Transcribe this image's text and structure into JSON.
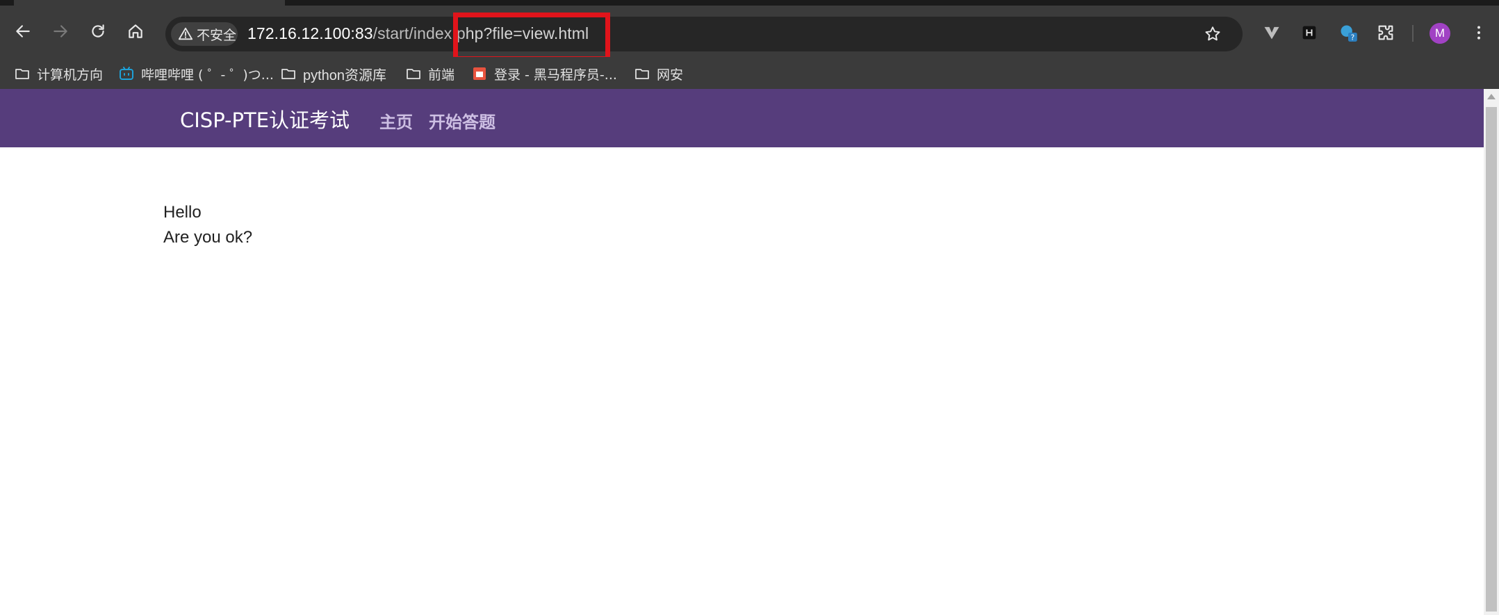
{
  "browser": {
    "security_label": "不安全",
    "url_host": "172.16.12.100:83",
    "url_path_before": "/start/index.p",
    "url_path_after": "hp?file=view.html",
    "avatar_initial": "M",
    "bookmarks": [
      {
        "label": "计算机方向",
        "icon": "folder-icon"
      },
      {
        "label": "哔哩哔哩 ( ゜- ゜)つ...",
        "icon": "bilibili-icon"
      },
      {
        "label": "python资源库",
        "icon": "folder-icon"
      },
      {
        "label": "前端",
        "icon": "folder-icon"
      },
      {
        "label": "登录 - 黑马程序员-...",
        "icon": "heima-icon"
      },
      {
        "label": "网安",
        "icon": "folder-icon"
      }
    ],
    "colors": {
      "chrome_bg": "#3b3b3b",
      "omnibox_bg": "#262626",
      "highlight": "#e0141b"
    }
  },
  "site": {
    "brand": "CISP-PTE认证考试",
    "nav": [
      {
        "label": "主页"
      },
      {
        "label": "开始答题"
      }
    ],
    "content_lines": [
      "Hello",
      "Are you ok?"
    ],
    "colors": {
      "nav_bg": "#563d7c",
      "nav_link": "#cdbfe3"
    }
  }
}
